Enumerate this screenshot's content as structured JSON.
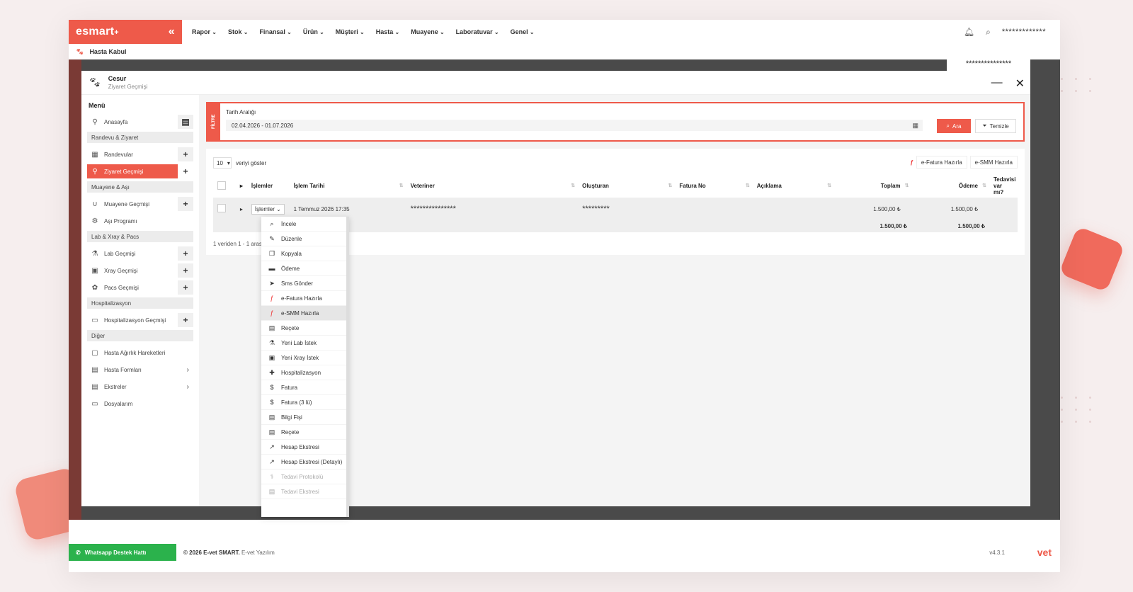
{
  "app": {
    "logo": "esmart",
    "logo_mark": "+",
    "collapse": "«",
    "nav": [
      "Rapor",
      "Stok",
      "Finansal",
      "Ürün",
      "Müşteri",
      "Hasta",
      "Muayene",
      "Laboratuvar",
      "Genel"
    ],
    "user_masked": "*************",
    "sub_title": "Hasta Kabul",
    "accent": "#ee5a4a"
  },
  "modal": {
    "patient": "Cesur",
    "page": "Ziyaret Geçmişi",
    "user_masked": "***************",
    "minimize": "—",
    "close": "✕"
  },
  "sidebar": {
    "title": "Menü",
    "items": [
      {
        "type": "item",
        "label": "Anasayfa",
        "icon": "⚲",
        "extra": "▤"
      },
      {
        "type": "group",
        "label": "Randevu & Ziyaret"
      },
      {
        "type": "item",
        "label": "Randevular",
        "icon": "▦",
        "extra": "+"
      },
      {
        "type": "item",
        "label": "Ziyaret Geçmişi",
        "icon": "⚲",
        "extra": "+",
        "active": true
      },
      {
        "type": "group",
        "label": "Muayene & Aşı"
      },
      {
        "type": "item",
        "label": "Muayene Geçmişi",
        "icon": "∪",
        "extra": "+"
      },
      {
        "type": "item",
        "label": "Aşı Programı",
        "icon": "⚙",
        "extra": ""
      },
      {
        "type": "group",
        "label": "Lab & Xray & Pacs"
      },
      {
        "type": "item",
        "label": "Lab Geçmişi",
        "icon": "⚗",
        "extra": "+"
      },
      {
        "type": "item",
        "label": "Xray Geçmişi",
        "icon": "▣",
        "extra": "+"
      },
      {
        "type": "item",
        "label": "Pacs Geçmişi",
        "icon": "✿",
        "extra": "+"
      },
      {
        "type": "group",
        "label": "Hospitalizasyon"
      },
      {
        "type": "item",
        "label": "Hospitalizasyon Geçmişi",
        "icon": "▭",
        "extra": "+"
      },
      {
        "type": "group",
        "label": "Diğer"
      },
      {
        "type": "item",
        "label": "Hasta Ağırlık Hareketleri",
        "icon": "▢",
        "extra": ""
      },
      {
        "type": "item",
        "label": "Hasta Formları",
        "icon": "▤",
        "extra": "›"
      },
      {
        "type": "item",
        "label": "Ekstreler",
        "icon": "▤",
        "extra": "›"
      },
      {
        "type": "item",
        "label": "Dosyalarım",
        "icon": "▭",
        "extra": ""
      }
    ]
  },
  "filter": {
    "tab": "FİLTRE",
    "label": "Tarih Aralığı",
    "value": "02.04.2026 - 01.07.2026",
    "search": "Ara",
    "clear": "Temizle"
  },
  "table": {
    "length_value": "10",
    "length_suffix": "veriyi göster",
    "actions": [
      "e-Fatura Hazırla",
      "e-SMM Hazırla"
    ],
    "headers": [
      "İşlemler",
      "İşlem Tarihi",
      "Veteriner",
      "Oluşturan",
      "Fatura No",
      "Açıklama",
      "Toplam",
      "Ödeme",
      "Tedavisi var mı?"
    ],
    "row": {
      "islem": "İşlemler",
      "date": "1 Temmuz 2026 17:35",
      "vet": "***************",
      "creator": "*********",
      "invoice": "",
      "desc": "",
      "total": "1.500,00 ₺",
      "paid": "1.500,00 ₺",
      "treat": ""
    },
    "totals": {
      "total": "1.500,00 ₺",
      "paid": "1.500,00 ₺"
    },
    "info": "1 veriden 1 - 1 arası"
  },
  "dropdown": [
    {
      "label": "İncele",
      "icon": "⌕"
    },
    {
      "label": "Düzenle",
      "icon": "✎"
    },
    {
      "label": "Kopyala",
      "icon": "❐"
    },
    {
      "label": "Ödeme",
      "icon": "▬"
    },
    {
      "label": "Sms Gönder",
      "icon": "➤"
    },
    {
      "label": "e-Fatura Hazırla",
      "icon": "ƒ",
      "red": true
    },
    {
      "label": "e-SMM Hazırla",
      "icon": "ƒ",
      "red": true,
      "hl": true
    },
    {
      "label": "Reçete",
      "icon": "▤"
    },
    {
      "label": "Yeni Lab İstek",
      "icon": "⚗"
    },
    {
      "label": "Yeni Xray İstek",
      "icon": "▣"
    },
    {
      "label": "Hospitalizasyon",
      "icon": "✚"
    },
    {
      "label": "Fatura",
      "icon": "$"
    },
    {
      "label": "Fatura (3 lü)",
      "icon": "$"
    },
    {
      "label": "Bilgi Fişi",
      "icon": "▤"
    },
    {
      "label": "Reçete",
      "icon": "▤"
    },
    {
      "label": "Hesap Ekstresi",
      "icon": "↗"
    },
    {
      "label": "Hesap Ekstresi (Detaylı)",
      "icon": "↗"
    },
    {
      "label": "Tedavi Protokolü",
      "icon": "⚕",
      "dis": true
    },
    {
      "label": "Tedavi Ekstresi",
      "icon": "▤",
      "dis": true
    }
  ],
  "footer": {
    "whatsapp": "Whatsapp Destek Hattı",
    "copyright_bold": "© 2026 E-vet SMART.",
    "copyright_rest": "E-vet Yazılım",
    "version": "v4.3.1",
    "brand": "vet"
  }
}
